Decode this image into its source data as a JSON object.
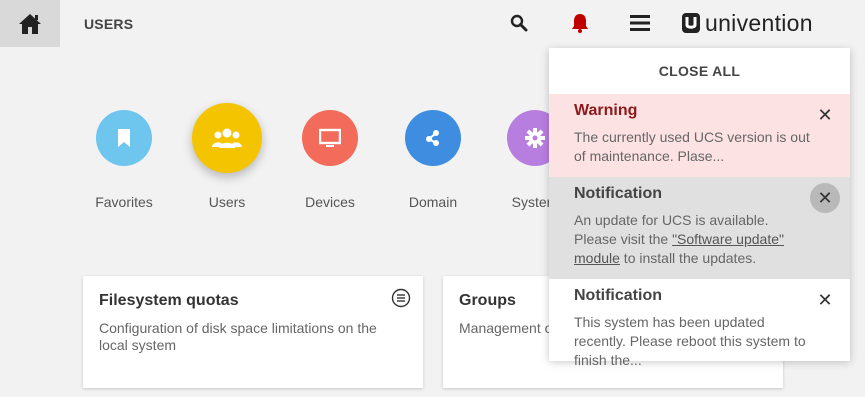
{
  "header": {
    "title": "USERS",
    "icons": [
      "home-icon",
      "search-icon",
      "bell-icon",
      "menu-icon"
    ],
    "logo_text": "univention",
    "bell_color": "#c00000"
  },
  "categories": [
    {
      "label": "Favorites",
      "color": "#6ec6ee",
      "icon": "bookmark-icon"
    },
    {
      "label": "Users",
      "color": "#f5c400",
      "icon": "users-icon",
      "active": true
    },
    {
      "label": "Devices",
      "color": "#f26b5b",
      "icon": "monitor-icon"
    },
    {
      "label": "Domain",
      "color": "#3e8de0",
      "icon": "share-icon"
    },
    {
      "label": "System",
      "color": "#b77ee0",
      "icon": "gear-icon"
    }
  ],
  "cards": [
    {
      "title": "Filesystem quotas",
      "desc": "Configuration of disk space limitations on the local system"
    },
    {
      "title": "Groups",
      "desc": "Management of groups for users of the domain"
    }
  ],
  "notifications": {
    "close_all": "CLOSE ALL",
    "items": [
      {
        "title": "Warning",
        "body": "The currently used UCS version is out of maintenance. Plase...",
        "type": "warning"
      },
      {
        "title": "Notification",
        "body_before": "An update for UCS is available. Please visit the ",
        "link": "\"Software update\" module",
        "body_after": " to install the updates.",
        "type": "grey"
      },
      {
        "title": "Notification",
        "body": "This system has been updated recently. Please reboot this system to finish the...",
        "type": "white"
      }
    ]
  }
}
